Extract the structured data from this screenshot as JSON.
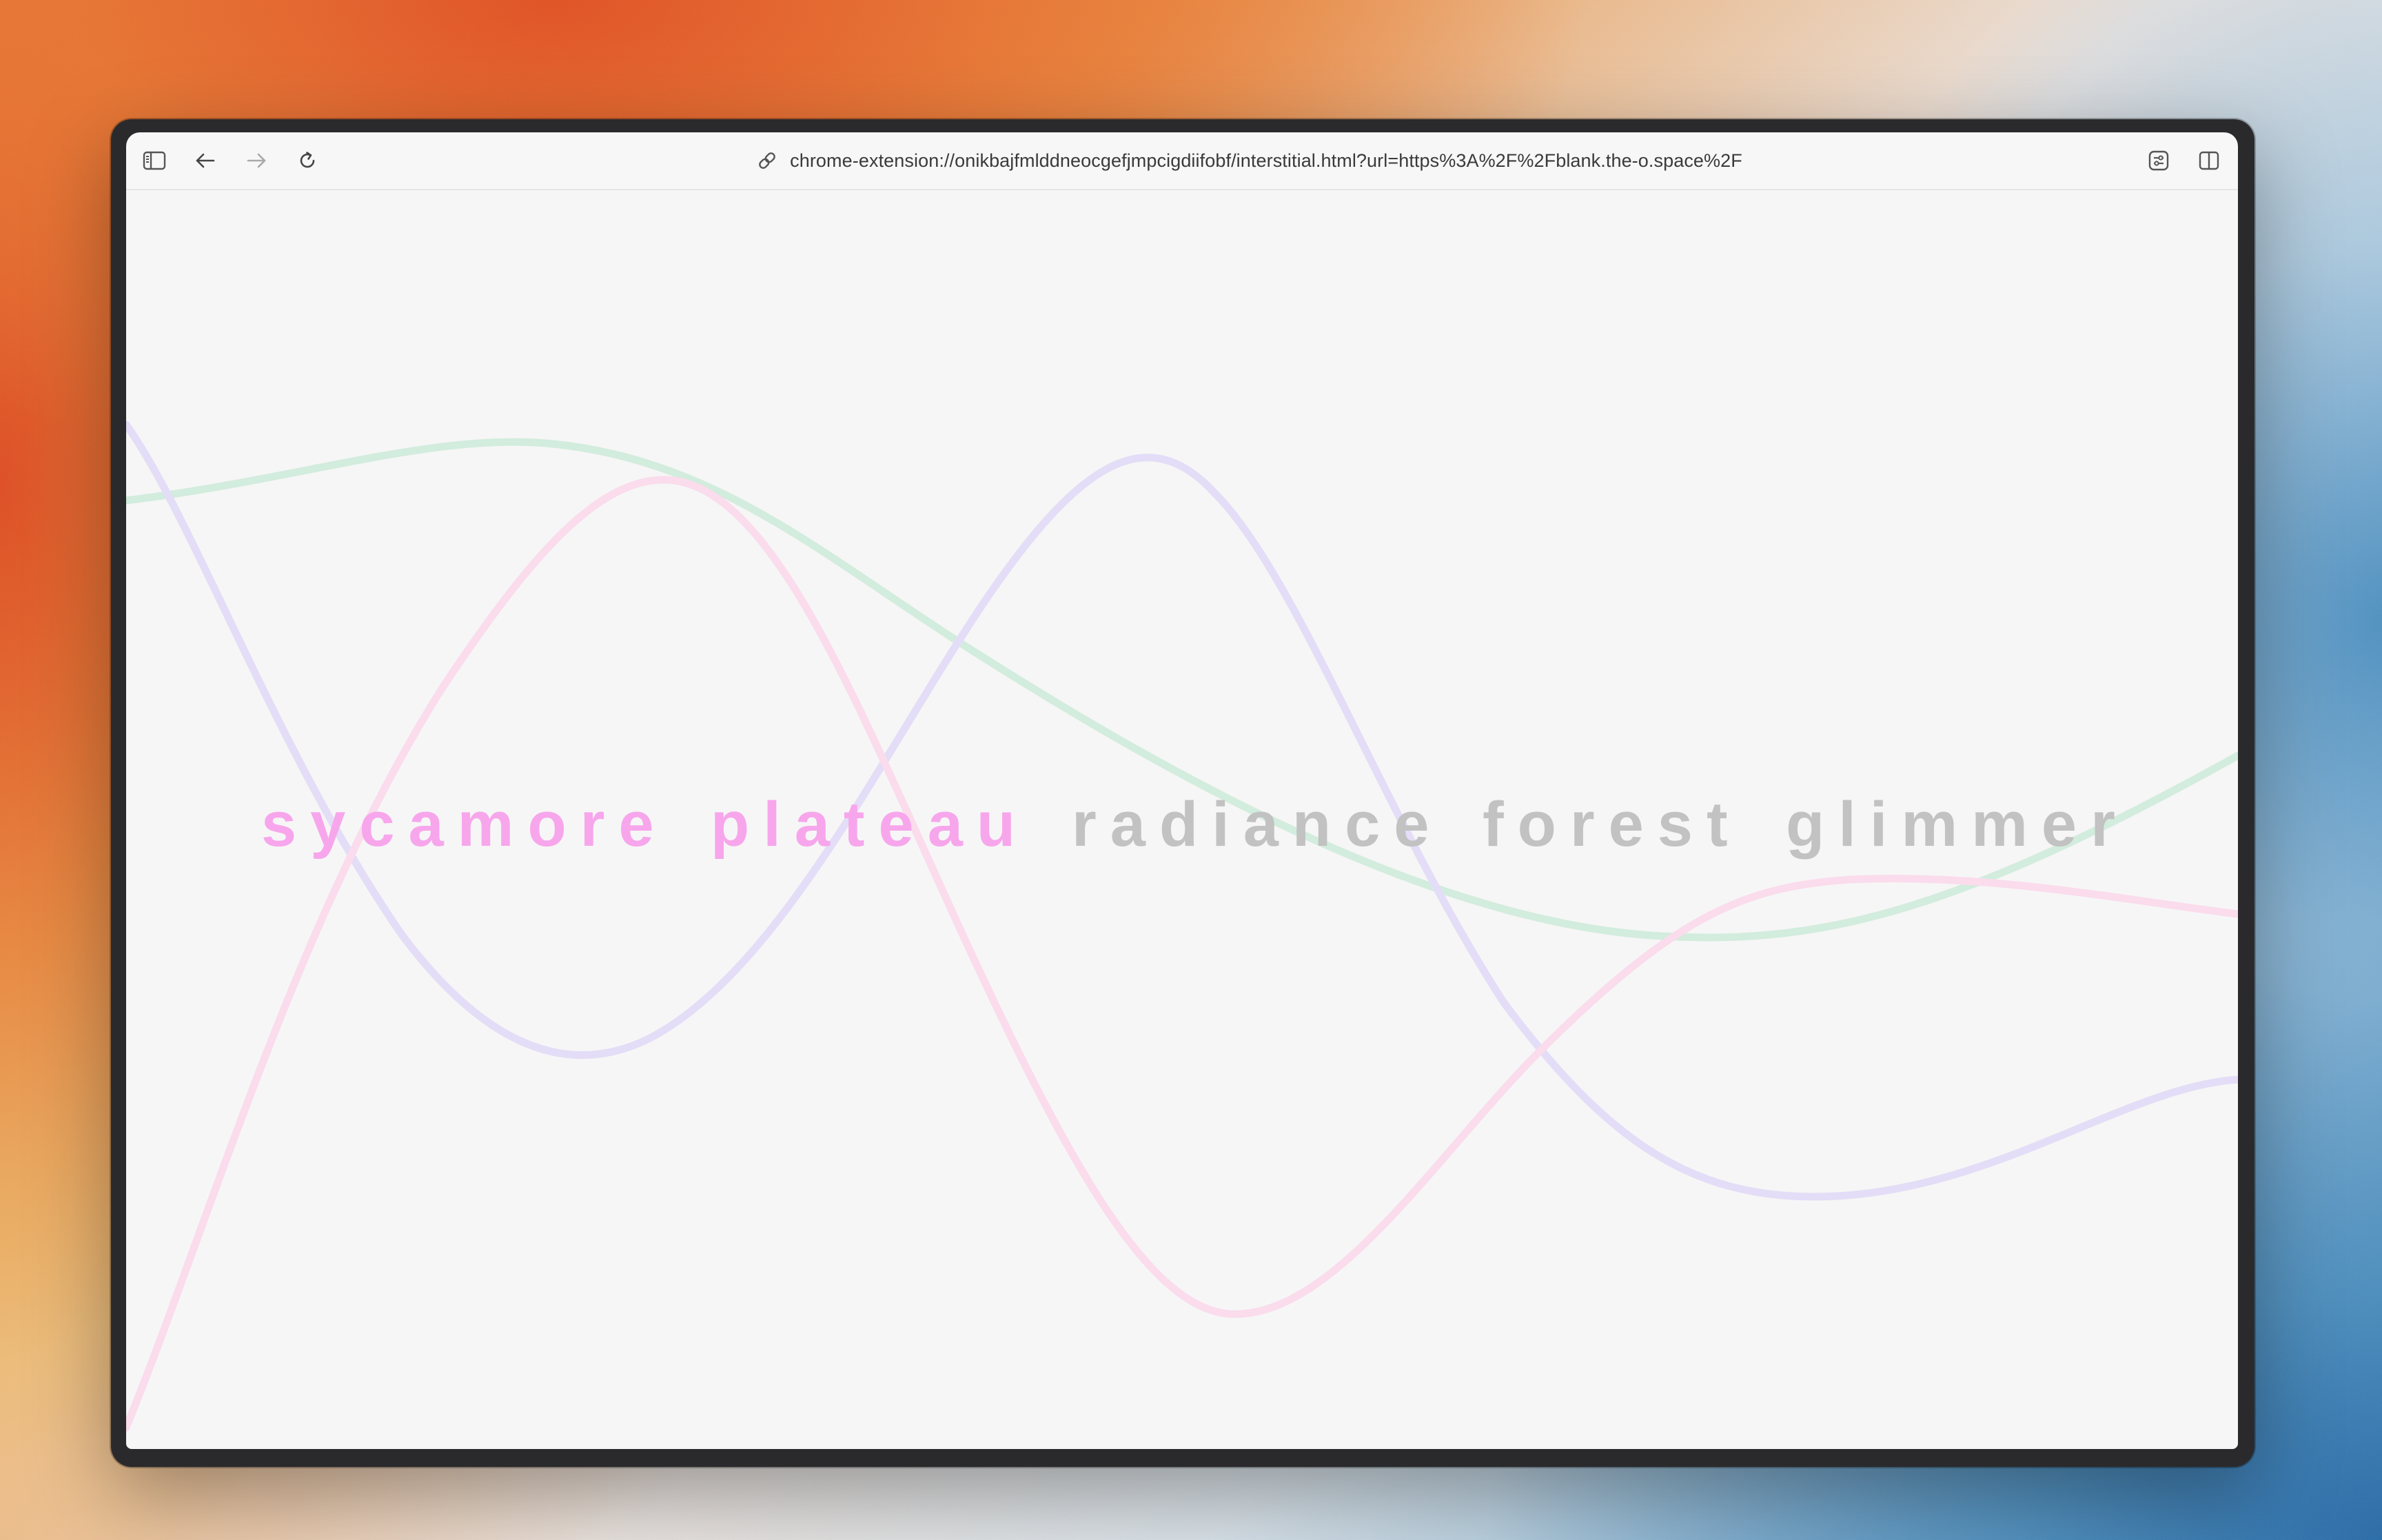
{
  "browser": {
    "url": "chrome-extension://onikbajfmlddneocgefjmpcigdiifobf/interstitial.html?url=https%3A%2F%2Fblank.the-o.space%2F",
    "icons": {
      "sidebar_toggle": "sidebar-icon",
      "back": "arrow-left-icon",
      "forward": "arrow-right-icon",
      "reload": "reload-icon",
      "link": "link-icon",
      "customize": "sliders-icon",
      "split_view": "split-view-icon"
    },
    "forward_enabled": false
  },
  "page": {
    "background_color": "#f6f6f6",
    "words": [
      {
        "text": "sycamore",
        "color": "#f7a6ec"
      },
      {
        "text": "plateau",
        "color": "#f7a6ec"
      },
      {
        "text": "radiance",
        "color": "#c2c2c2"
      },
      {
        "text": "forest",
        "color": "#c2c2c2"
      },
      {
        "text": "glimmer",
        "color": "#c2c2c2"
      }
    ],
    "wave_colors": {
      "green": "#d2ecdd",
      "purple": "#e3ddf7",
      "pink": "#fadcec"
    }
  }
}
